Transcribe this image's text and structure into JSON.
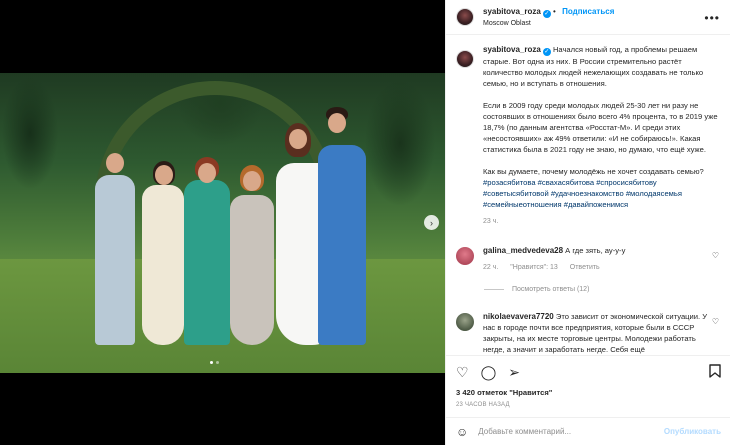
{
  "post": {
    "username": "syabitova_roza",
    "follow_label": "Подписаться",
    "location": "Moscow Oblast",
    "more_label": "•••",
    "verified_mark": "✓"
  },
  "media": {
    "next_icon": "›"
  },
  "caption": {
    "username": "syabitova_roza",
    "p1": "Начался новый год, а проблемы решаем старые. Вот одна из них. В России стремительно растёт количество молодых людей нежелающих создавать не только семью, но и вступать в отношения.",
    "p2": "Если в 2009 году среди молодых людей 25-30 лет ни разу не состоявших в отношениях было всего 4% процента, то в 2019 уже 18,7% (по данным агентства «Росстат-М». И среди этих «несостоявших» аж 49% ответили: «И не собираюсь!». Какая статистика была в 2021 году не знаю, но думаю, что ещё хуже.",
    "p3": "Как вы думаете, почему молодёжь не хочет создавать семью?",
    "tags": "#розасябитова #свахасябитова #спросисябитову #советысябитовой #удачноезнакомство #молодаясемья #семейныеотношения #давайпоженимся",
    "time": "23 ч."
  },
  "comments": [
    {
      "username": "galina_medvedeva28",
      "text": "А где зять, ау-у-у",
      "time": "22 ч.",
      "likes": "\"Нравится\": 13",
      "reply": "Ответить",
      "view_replies": "Посмотреть ответы (12)"
    },
    {
      "username": "nikolaevavera7720",
      "text": "Это зависит от экономической ситуации. У нас в городе почти все предприятия, которые были в СССР закрыты, на их месте торговые центры. Молодежи работать негде, а значит и заработать негде. Себя ещё"
    }
  ],
  "footer": {
    "likes": "3 420 отметок \"Нравится\"",
    "time": "23 ЧАСОВ НАЗАД",
    "add_comment_placeholder": "Добавьте комментарий...",
    "post_button": "Опубликовать"
  },
  "icons": {
    "like": "heart-icon",
    "comment": "comment-icon",
    "share": "send-icon",
    "save": "bookmark-icon",
    "emoji": "emoji-icon"
  },
  "colors": {
    "accent": "#0095f6",
    "hashtag": "#00376b",
    "muted": "#8e8e8e"
  }
}
